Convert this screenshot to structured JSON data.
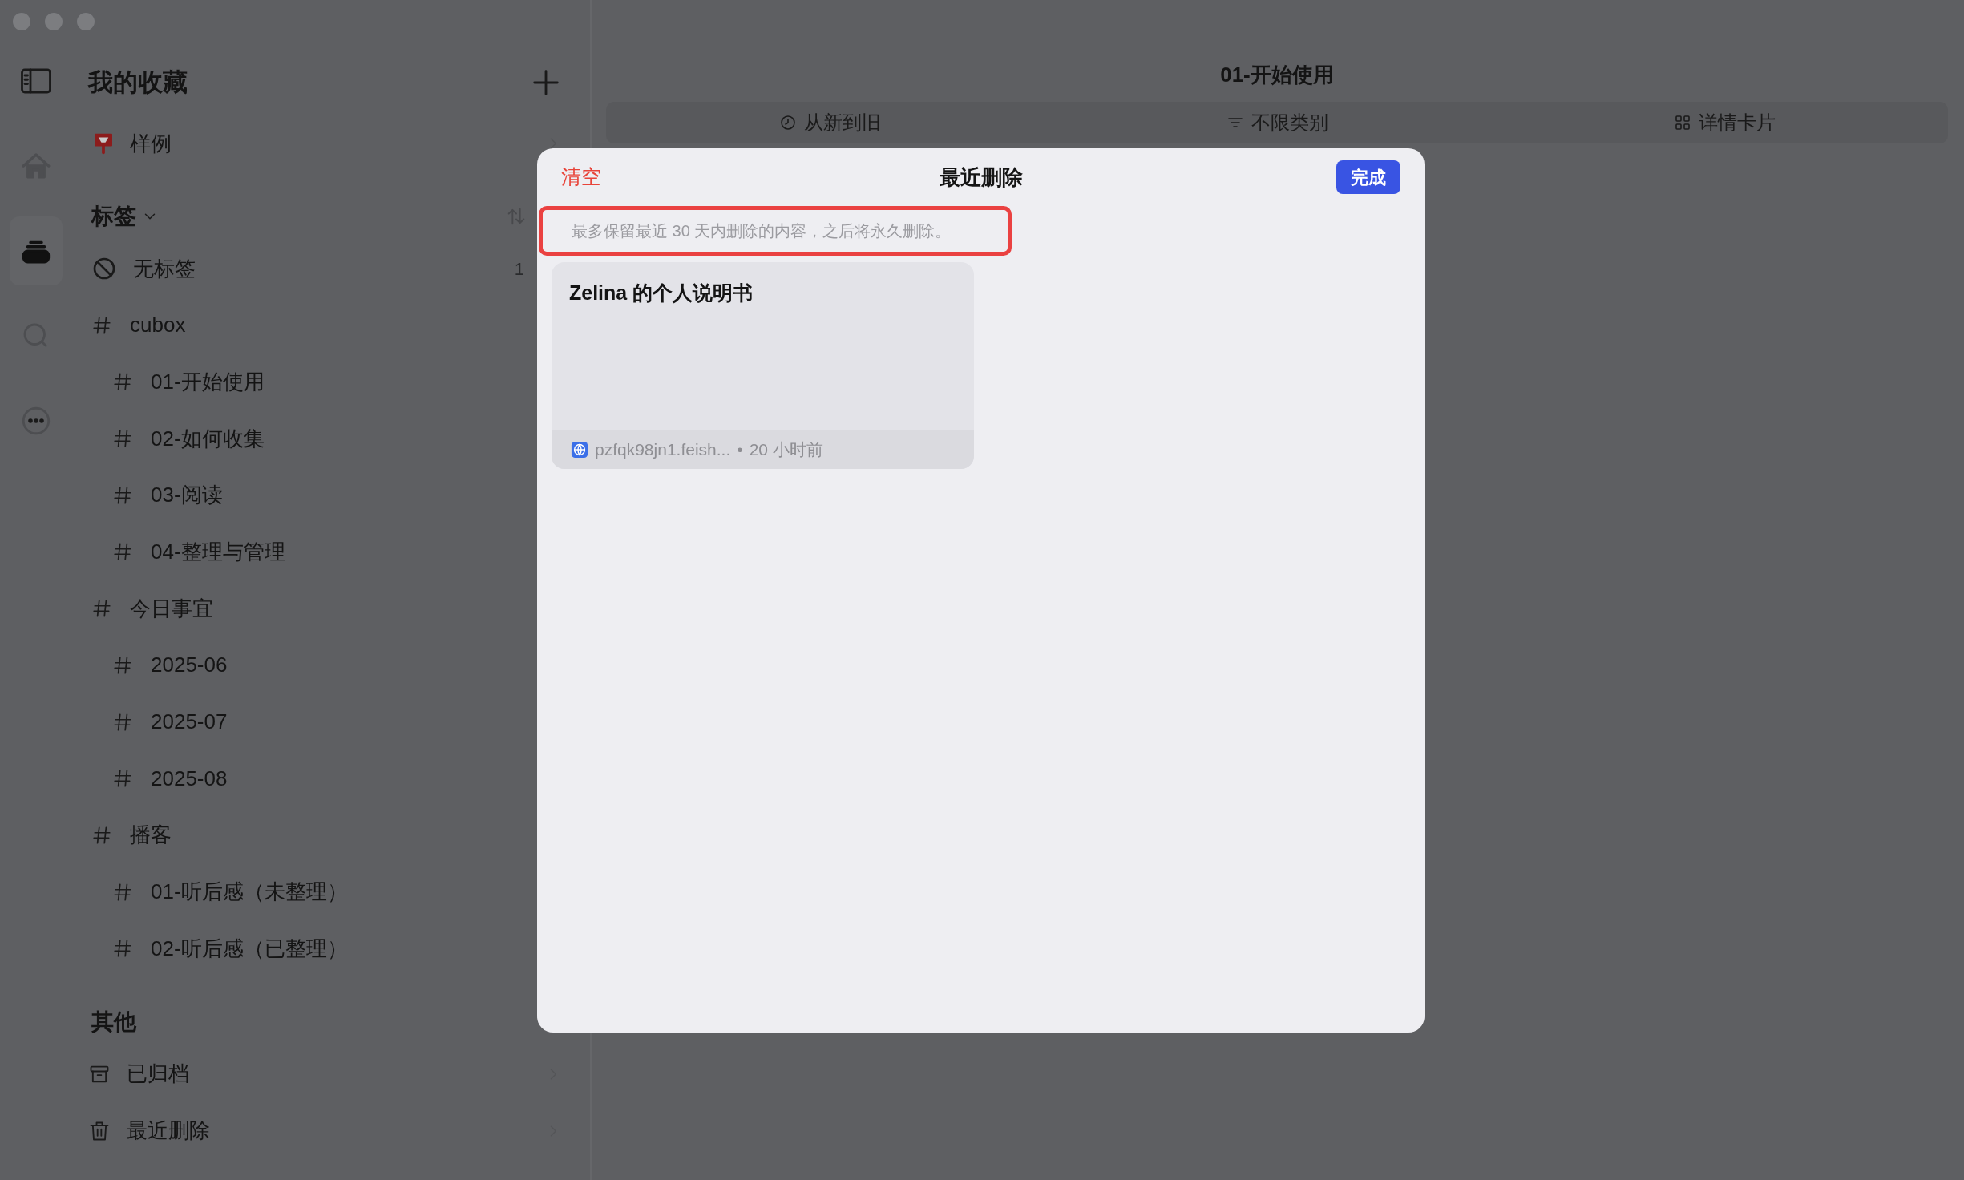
{
  "rail": [
    {
      "kind": "sidebar-toggle",
      "selected": false
    },
    {
      "kind": "home",
      "selected": false
    },
    {
      "kind": "stack",
      "selected": true
    },
    {
      "kind": "search",
      "selected": false
    },
    {
      "kind": "more",
      "selected": false
    }
  ],
  "sidebar": {
    "title": "我的收藏",
    "pinned": [
      {
        "label": "样例"
      }
    ],
    "tags_header": {
      "label": "标签",
      "expanded": true
    },
    "untagged": {
      "label": "无标签",
      "count": "1"
    },
    "tags": [
      {
        "label": "cubox",
        "children": [
          {
            "label": "01-开始使用"
          },
          {
            "label": "02-如何收集"
          },
          {
            "label": "03-阅读"
          },
          {
            "label": "04-整理与管理"
          }
        ]
      },
      {
        "label": "今日事宜",
        "children": [
          {
            "label": "2025-06"
          },
          {
            "label": "2025-07"
          },
          {
            "label": "2025-08"
          }
        ]
      },
      {
        "label": "播客",
        "children": [
          {
            "label": "01-听后感（未整理）"
          },
          {
            "label": "02-听后感（已整理）"
          }
        ]
      }
    ],
    "other_header": "其他",
    "other_items": [
      {
        "kind": "archive",
        "label": "已归档"
      },
      {
        "kind": "trash",
        "label": "最近删除"
      }
    ]
  },
  "main": {
    "title": "01-开始使用",
    "toolbar": [
      {
        "kind": "sort",
        "label": "从新到旧"
      },
      {
        "kind": "filter",
        "label": "不限类别"
      },
      {
        "kind": "view",
        "label": "详情卡片"
      }
    ]
  },
  "dialog": {
    "clear_label": "清空",
    "title": "最近删除",
    "done_label": "完成",
    "notice": "最多保留最近 30 天内删除的内容，之后将永久删除。",
    "items": [
      {
        "title": "Zelina 的个人说明书",
        "source": "pzfqk98jn1.feish...",
        "separator": "•",
        "time": "20 小时前"
      }
    ]
  }
}
